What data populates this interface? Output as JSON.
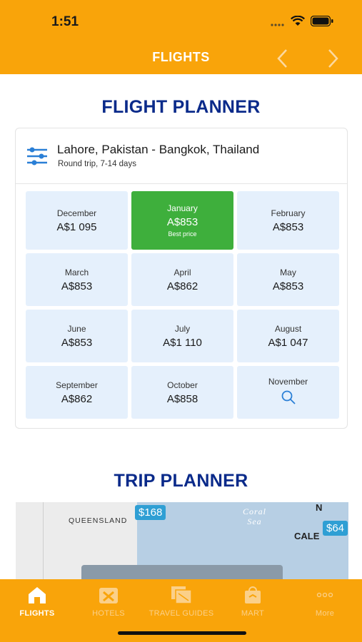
{
  "status": {
    "time": "1:51"
  },
  "nav": {
    "title": "FLIGHTS"
  },
  "flight_planner": {
    "title": "FLIGHT PLANNER",
    "route": "Lahore, Pakistan - Bangkok, Thailand",
    "subtitle": "Round trip, 7-14 days",
    "months": [
      {
        "month": "December",
        "price": "A$1 095"
      },
      {
        "month": "January",
        "price": "A$853",
        "note": "Best price"
      },
      {
        "month": "February",
        "price": "A$853"
      },
      {
        "month": "March",
        "price": "A$853"
      },
      {
        "month": "April",
        "price": "A$862"
      },
      {
        "month": "May",
        "price": "A$853"
      },
      {
        "month": "June",
        "price": "A$853"
      },
      {
        "month": "July",
        "price": "A$1 110"
      },
      {
        "month": "August",
        "price": "A$1 047"
      },
      {
        "month": "September",
        "price": "A$862"
      },
      {
        "month": "October",
        "price": "A$858"
      },
      {
        "month": "November",
        "icon": "search-icon"
      }
    ]
  },
  "trip_planner": {
    "title": "TRIP PLANNER",
    "map": {
      "region_label": "QUEENSLAND",
      "sea_label_1": "Coral",
      "sea_label_2": "Sea",
      "place_label_1": "N",
      "place_label_2": "CALE",
      "pin_1": "$168",
      "pin_2": "$64"
    }
  },
  "tabs": [
    {
      "label": "FLIGHTS",
      "icon": "home-icon",
      "active": true
    },
    {
      "label": "HOTELS",
      "icon": "hotel-icon"
    },
    {
      "label": "TRAVEL GUIDES",
      "icon": "guides-icon"
    },
    {
      "label": "MART",
      "icon": "mart-icon"
    },
    {
      "label": "More",
      "icon": "more-icon"
    }
  ],
  "colors": {
    "brand": "#f9a40a",
    "title": "#0a2a8a",
    "best": "#3eaf3c",
    "cell": "#e5f0fc",
    "pin": "#2f9fd4"
  }
}
